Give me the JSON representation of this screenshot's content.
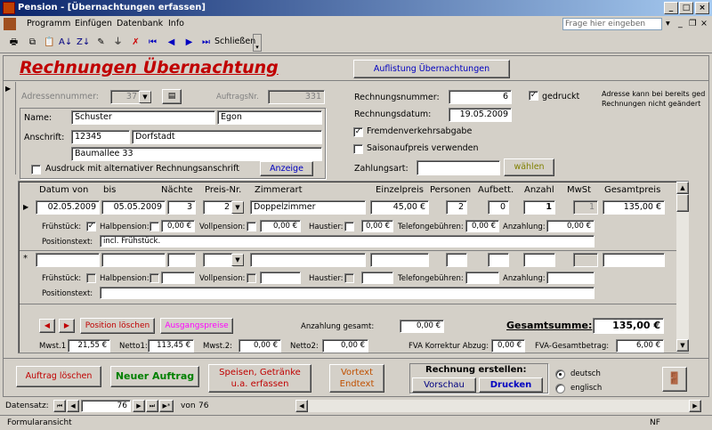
{
  "window": {
    "title": "Pension - [Übernachtungen erfassen]",
    "help_placeholder": "Frage hier eingeben"
  },
  "menu": [
    "Programm",
    "Einfügen",
    "Datenbank",
    "Info"
  ],
  "toolbar": {
    "close_label": "Schließen"
  },
  "form": {
    "title": "Rechnungen Übernachtung",
    "list_button": "Auflistung Übernachtungen",
    "adressnr_label": "Adressennummer:",
    "adressnr_value": "37",
    "auftragsnr_label": "AuftragsNr.",
    "auftragsnr_value": "331",
    "name_label": "Name:",
    "first_name": "Schuster",
    "last_name": "Egon",
    "address_label": "Anschrift:",
    "zip": "12345",
    "city": "Dorfstadt",
    "street": "Baumallee 33",
    "alt_address_label": "Ausdruck mit alternativer Rechnungsanschrift",
    "show_button": "Anzeige",
    "invoice_nr_label": "Rechnungsnummer:",
    "invoice_nr": "6",
    "invoice_date_label": "Rechnungsdatum:",
    "invoice_date": "19.05.2009",
    "printed_label": "gedruckt",
    "note_line1": "Adresse kann bei bereits ged",
    "note_line2": "Rechnungen nicht geändert",
    "tourist_tax_label": "Fremdenverkehrsabgabe",
    "season_label": "Saisonaufpreis verwenden",
    "payment_label": "Zahlungsart:",
    "choose_button": "wählen"
  },
  "table": {
    "headers": [
      "Datum von",
      "bis",
      "Nächte",
      "Preis-Nr.",
      "Zimmerart",
      "Einzelpreis",
      "Personen",
      "Aufbett.",
      "Anzahl",
      "MwSt",
      "Gesamtpreis"
    ],
    "row1": {
      "from": "02.05.2009",
      "to": "05.05.2009",
      "nights": "3",
      "price_nr": "2",
      "room": "Doppelzimmer",
      "unit_price": "45,00 €",
      "persons": "2",
      "extra_bed": "0",
      "count": "1",
      "vat": "1",
      "total": "135,00 €"
    },
    "sub_labels": {
      "breakfast": "Frühstück:",
      "half_board": "Halbpension:",
      "full_board": "Vollpension:",
      "pet": "Haustier:",
      "phone": "Telefongebühren:",
      "deposit": "Anzahlung:",
      "position_text": "Positionstext:"
    },
    "row1_sub": {
      "half_board": "0,00 €",
      "full_board": "0,00 €",
      "pet": "0,00 €",
      "phone": "0,00 €",
      "deposit": "0,00 €",
      "position_text": "incl. Frühstück."
    }
  },
  "footer": {
    "delete_position": "Position löschen",
    "outgoing_prices": "Ausgangspreise",
    "deposit_total_label": "Anzahlung gesamt:",
    "deposit_total": "0,00 €",
    "grand_total_label": "Gesamtsumme:",
    "grand_total": "135,00 €",
    "vat1_label": "Mwst.1",
    "vat1": "21,55 €",
    "net1_label": "Netto1:",
    "net1": "113,45 €",
    "vat2_label": "Mwst.2:",
    "vat2": "0,00 €",
    "net2_label": "Netto2:",
    "net2": "0,00 €",
    "fva_correction_label": "FVA Korrektur Abzug:",
    "fva_correction": "0,00 €",
    "fva_total_label": "FVA-Gesamtbetrag:",
    "fva_total": "6,00 €"
  },
  "actions": {
    "delete_order": "Auftrag löschen",
    "new_order": "Neuer Auftrag",
    "food_btn_line1": "Speisen, Getränke",
    "food_btn_line2": "u.a. erfassen",
    "pretext_line1": "Vortext",
    "pretext_line2": "Endtext",
    "create_invoice_label": "Rechnung erstellen:",
    "preview": "Vorschau",
    "print": "Drucken",
    "lang_de": "deutsch",
    "lang_en": "englisch"
  },
  "nav": {
    "label": "Datensatz:",
    "current": "76",
    "of": "von",
    "total": "76"
  },
  "status": {
    "mode": "Formularansicht",
    "nf": "NF"
  },
  "colors": {
    "title_red": "#c00000",
    "accent_blue": "#0000c0",
    "green": "#008000",
    "magenta": "#ff00ff"
  }
}
